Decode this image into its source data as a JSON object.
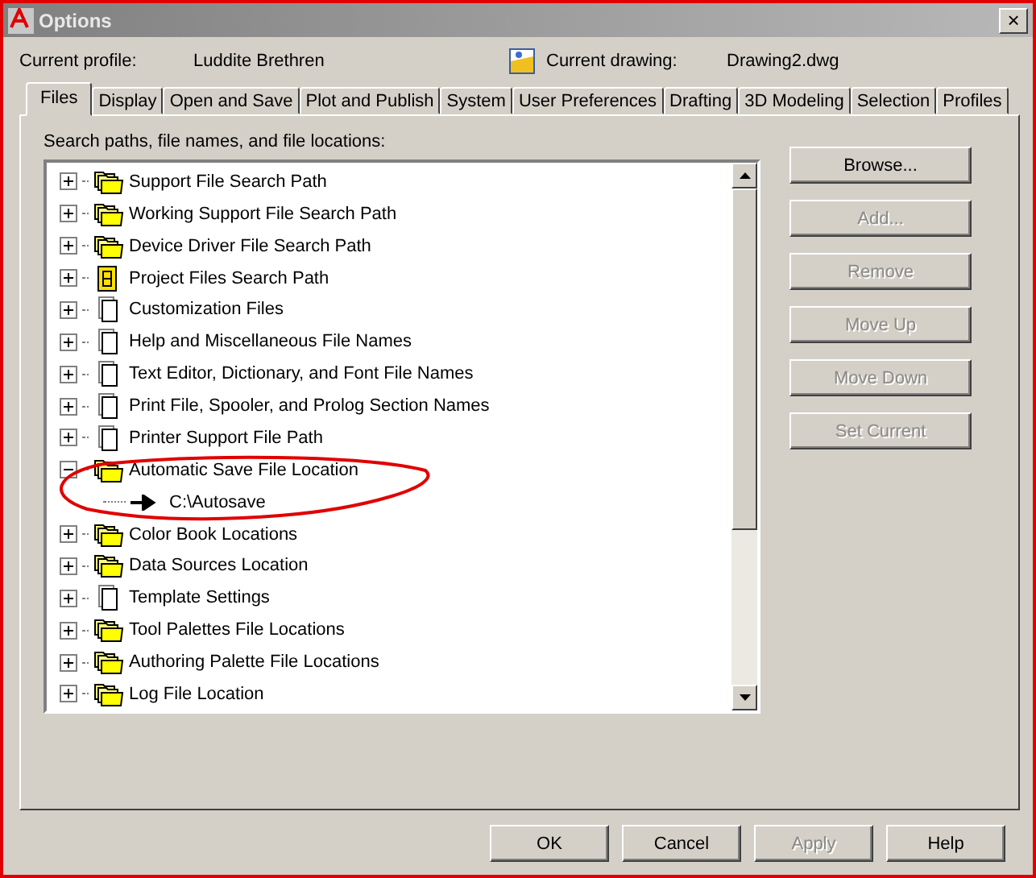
{
  "window": {
    "title": "Options",
    "close": "×"
  },
  "profile": {
    "label": "Current profile:",
    "value": "Luddite Brethren"
  },
  "drawing": {
    "label": "Current drawing:",
    "value": "Drawing2.dwg"
  },
  "tabs": [
    {
      "label": "Files",
      "selected": true
    },
    {
      "label": "Display",
      "selected": false
    },
    {
      "label": "Open and Save",
      "selected": false
    },
    {
      "label": "Plot and Publish",
      "selected": false
    },
    {
      "label": "System",
      "selected": false
    },
    {
      "label": "User Preferences",
      "selected": false
    },
    {
      "label": "Drafting",
      "selected": false
    },
    {
      "label": "3D Modeling",
      "selected": false
    },
    {
      "label": "Selection",
      "selected": false
    },
    {
      "label": "Profiles",
      "selected": false
    }
  ],
  "tree_label": "Search paths, file names, and file locations:",
  "tree": [
    {
      "label": "Support File Search Path",
      "kind": "folders",
      "expanded": false
    },
    {
      "label": "Working Support File Search Path",
      "kind": "folders",
      "expanded": false
    },
    {
      "label": "Device Driver File Search Path",
      "kind": "folders",
      "expanded": false
    },
    {
      "label": "Project Files Search Path",
      "kind": "project",
      "expanded": false
    },
    {
      "label": "Customization Files",
      "kind": "files",
      "expanded": false
    },
    {
      "label": "Help and Miscellaneous File Names",
      "kind": "files",
      "expanded": false
    },
    {
      "label": "Text Editor, Dictionary, and Font File Names",
      "kind": "files",
      "expanded": false
    },
    {
      "label": "Print File, Spooler, and Prolog Section Names",
      "kind": "files",
      "expanded": false
    },
    {
      "label": "Printer Support File Path",
      "kind": "files",
      "expanded": false
    },
    {
      "label": "Automatic Save File Location",
      "kind": "folders",
      "expanded": true,
      "children": [
        {
          "label": "C:\\Autosave"
        }
      ]
    },
    {
      "label": "Color Book Locations",
      "kind": "folders",
      "expanded": false
    },
    {
      "label": "Data Sources Location",
      "kind": "folders",
      "expanded": false
    },
    {
      "label": "Template Settings",
      "kind": "files",
      "expanded": false
    },
    {
      "label": "Tool Palettes File Locations",
      "kind": "folders",
      "expanded": false
    },
    {
      "label": "Authoring Palette File Locations",
      "kind": "folders",
      "expanded": false
    },
    {
      "label": "Log File Location",
      "kind": "folders",
      "expanded": false
    }
  ],
  "side_buttons": [
    {
      "label": "Browse...",
      "disabled": false
    },
    {
      "label": "Add...",
      "disabled": true
    },
    {
      "label": "Remove",
      "disabled": true
    },
    {
      "label": "Move Up",
      "disabled": true
    },
    {
      "label": "Move Down",
      "disabled": true
    },
    {
      "label": "Set Current",
      "disabled": true
    }
  ],
  "bottom_buttons": [
    {
      "label": "OK",
      "disabled": false
    },
    {
      "label": "Cancel",
      "disabled": false
    },
    {
      "label": "Apply",
      "disabled": true
    },
    {
      "label": "Help",
      "disabled": false
    }
  ]
}
